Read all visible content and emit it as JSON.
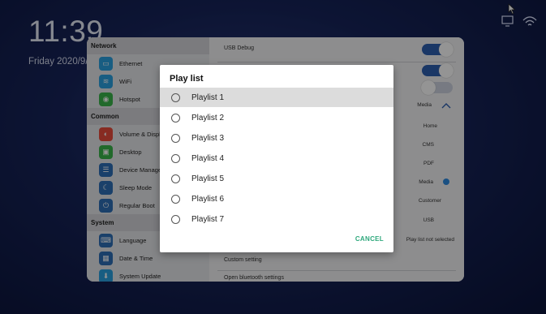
{
  "clock": "11:39",
  "date": "Friday 2020/9/",
  "sidebar": {
    "sections": [
      {
        "title": "Network",
        "items": [
          {
            "label": "Ethernet",
            "icon": "ethernet-icon",
            "color": "#2aa1e0"
          },
          {
            "label": "WiFi",
            "icon": "wifi-icon",
            "color": "#2aa1e0"
          },
          {
            "label": "Hotspot",
            "icon": "hotspot-icon",
            "color": "#39b54a"
          }
        ]
      },
      {
        "title": "Common",
        "items": [
          {
            "label": "Volume & Displ",
            "icon": "volume-icon",
            "color": "#e94b3c"
          },
          {
            "label": "Desktop",
            "icon": "desktop-icon",
            "color": "#39b54a"
          },
          {
            "label": "Device Manage",
            "icon": "device-icon",
            "color": "#2d6fb7"
          },
          {
            "label": "Sleep Mode",
            "icon": "sleep-icon",
            "color": "#2d6fb7"
          },
          {
            "label": "Regular Boot",
            "icon": "power-icon",
            "color": "#2d6fb7"
          }
        ]
      },
      {
        "title": "System",
        "items": [
          {
            "label": "Language",
            "icon": "language-icon",
            "color": "#2d6fb7"
          },
          {
            "label": "Date & Time",
            "icon": "date-time-icon",
            "color": "#2d6fb7"
          },
          {
            "label": "System Update",
            "icon": "system-update-icon",
            "color": "#2aa1e0"
          }
        ]
      }
    ]
  },
  "content": {
    "usb_debug": "USB Debug",
    "media_label": "Media",
    "options": [
      "Home",
      "CMS",
      "PDF",
      "Media",
      "Customer",
      "USB"
    ],
    "play_list_status": "Play list not selected",
    "custom_setting": "Custom setting",
    "open_bluetooth": "Open bluetooth settings"
  },
  "dialog": {
    "title": "Play list",
    "items": [
      "Playlist 1",
      "Playlist 2",
      "Playlist 3",
      "Playlist 4",
      "Playlist 5",
      "Playlist 6",
      "Playlist 7"
    ],
    "cancel": "CANCEL"
  },
  "colors": {
    "toggle_on": "#2e5fb0",
    "toggle_off": "#cdd3e0",
    "accent": "#2ea87c"
  }
}
